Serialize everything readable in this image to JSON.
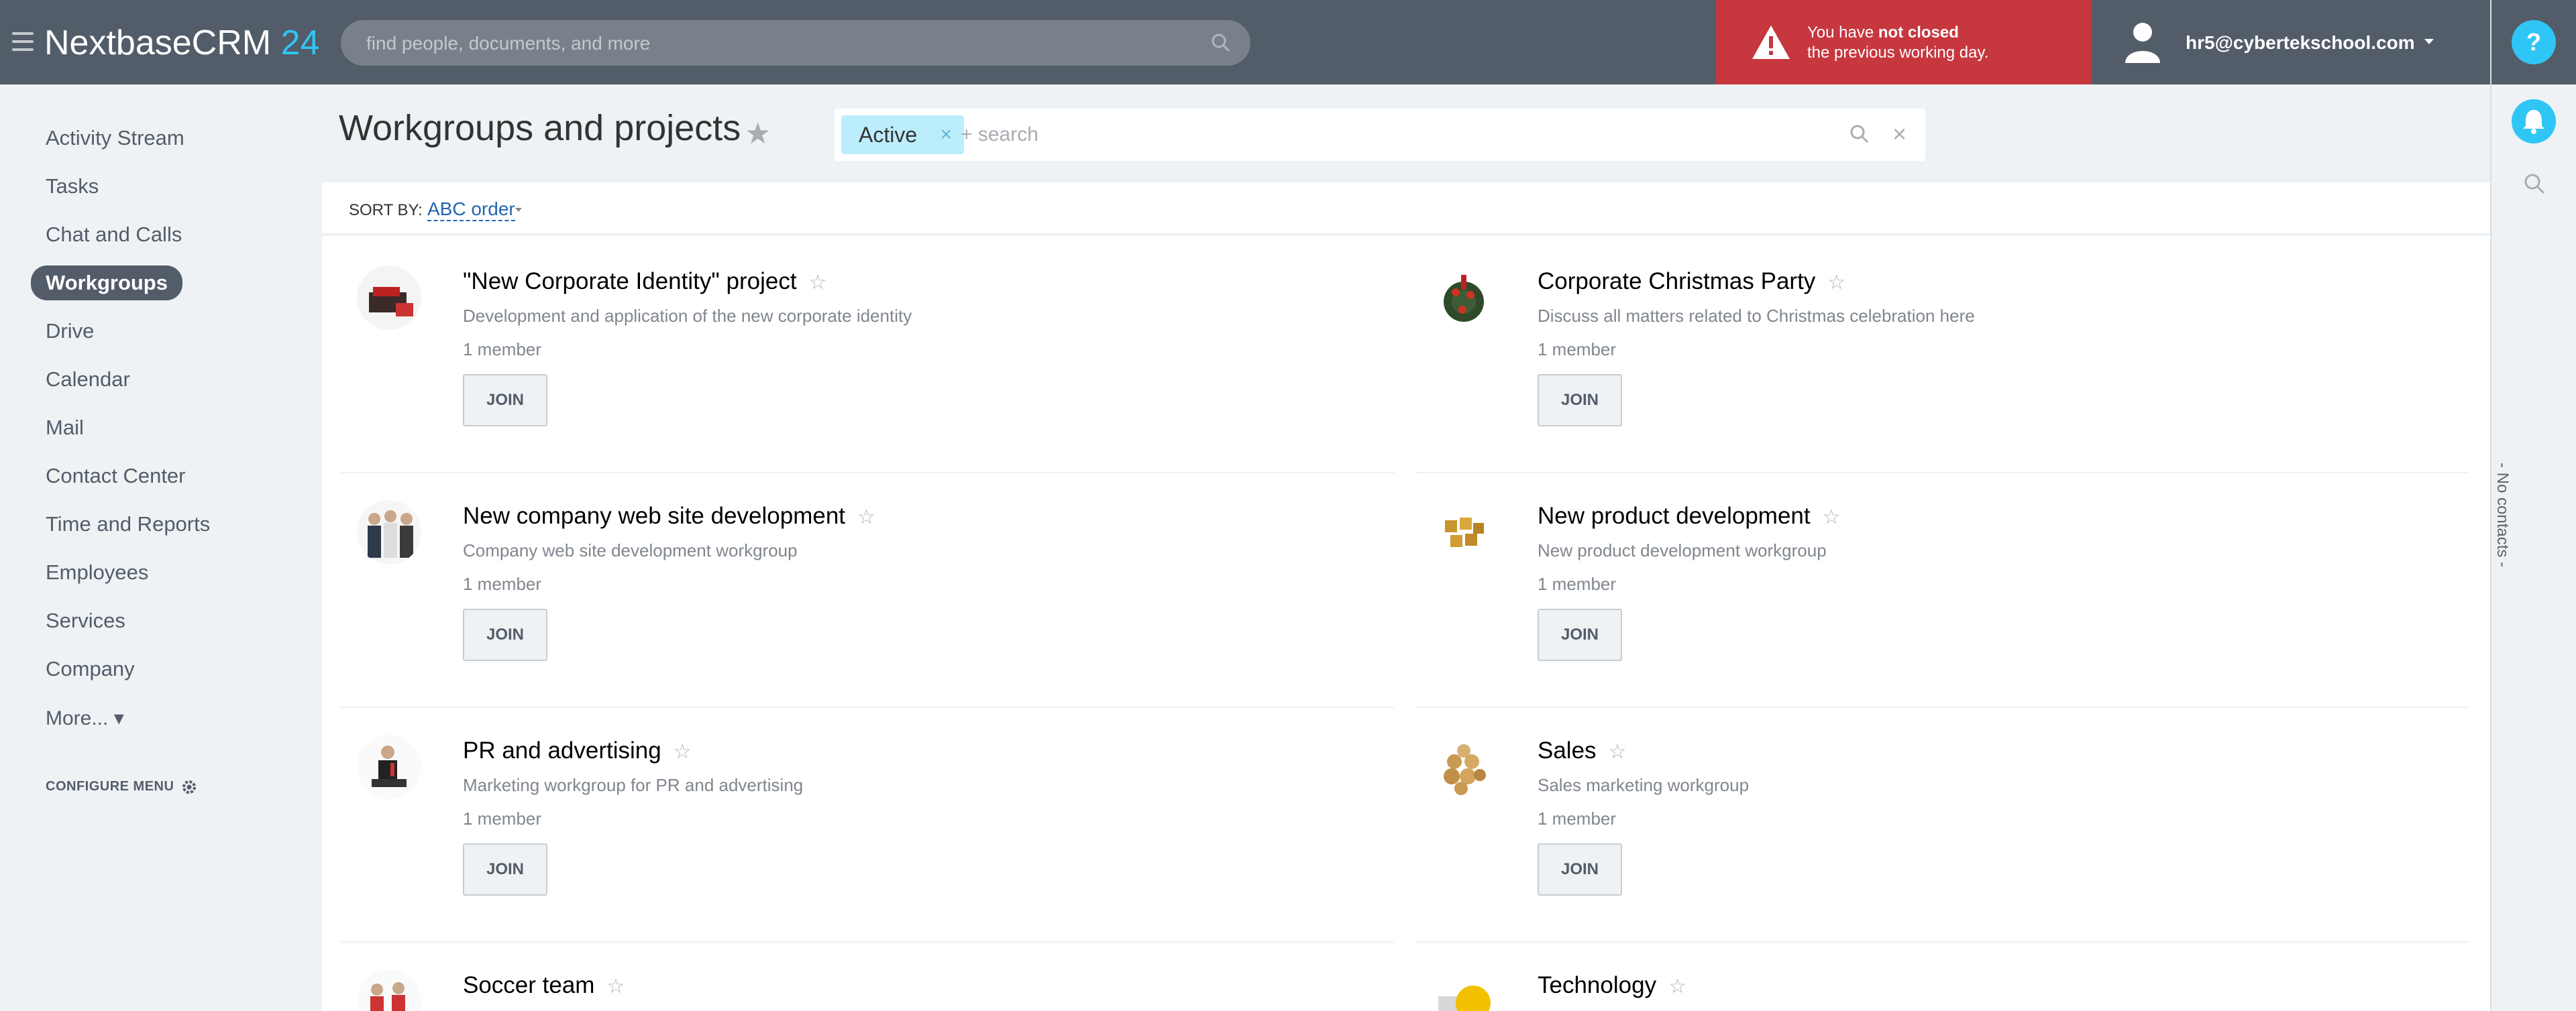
{
  "header": {
    "logo_name": "NextbaseCRM",
    "logo_number": "24",
    "search_placeholder": "find people, documents, and more",
    "alert_line1_prefix": "You have ",
    "alert_line1_bold": "not closed",
    "alert_line2": "the previous working day.",
    "user_email": "hr5@cyberteksсhool.com",
    "help_label": "?"
  },
  "sidebar": {
    "items": [
      {
        "label": "Activity Stream"
      },
      {
        "label": "Tasks"
      },
      {
        "label": "Chat and Calls"
      },
      {
        "label": "Workgroups",
        "active": true
      },
      {
        "label": "Drive"
      },
      {
        "label": "Calendar"
      },
      {
        "label": "Mail"
      },
      {
        "label": "Contact Center"
      },
      {
        "label": "Time and Reports"
      },
      {
        "label": "Employees"
      },
      {
        "label": "Services"
      },
      {
        "label": "Company"
      },
      {
        "label": "More... ▾"
      }
    ],
    "configure_label": "CONFIGURE MENU"
  },
  "main": {
    "title": "Workgroups and projects",
    "filter_tag": "Active",
    "filter_placeholder": "+ search",
    "sort_label": "SORT BY:",
    "sort_value": "ABC order"
  },
  "rail": {
    "no_contacts": "- No contacts -"
  },
  "groups": [
    {
      "name": "\"New Corporate Identity\" project",
      "description": "Development and application of the new corporate identity",
      "members": "1 member",
      "join_label": "JOIN"
    },
    {
      "name": "Corporate Christmas Party",
      "description": "Discuss all matters related to Christmas celebration here",
      "members": "1 member",
      "join_label": "JOIN"
    },
    {
      "name": "New company web site development",
      "description": "Company web site development workgroup",
      "members": "1 member",
      "join_label": "JOIN"
    },
    {
      "name": "New product development",
      "description": "New product development workgroup",
      "members": "1 member",
      "join_label": "JOIN"
    },
    {
      "name": "PR and advertising",
      "description": "Marketing workgroup for PR and advertising",
      "members": "1 member",
      "join_label": "JOIN"
    },
    {
      "name": "Sales",
      "description": "Sales marketing workgroup",
      "members": "1 member",
      "join_label": "JOIN"
    },
    {
      "name": "Soccer team",
      "description": "",
      "members": "",
      "join_label": ""
    },
    {
      "name": "Technology",
      "description": "",
      "members": "",
      "join_label": ""
    }
  ]
}
